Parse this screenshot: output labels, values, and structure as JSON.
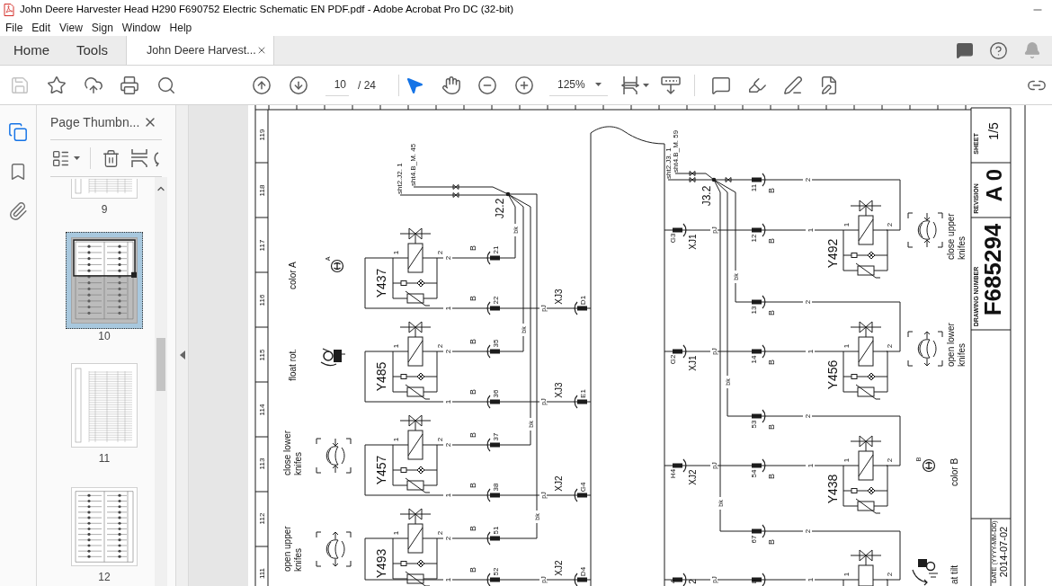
{
  "window": {
    "title": "John Deere Harvester Head H290 F690752 Electric Schematic EN PDF.pdf - Adobe Acrobat Pro DC (32-bit)"
  },
  "menu": [
    "File",
    "Edit",
    "View",
    "Sign",
    "Window",
    "Help"
  ],
  "tabs": [
    {
      "label": "Home",
      "kind": "nav",
      "selected": false
    },
    {
      "label": "Tools",
      "kind": "nav",
      "selected": false
    },
    {
      "label": "John Deere Harvest...",
      "kind": "document",
      "selected": true
    }
  ],
  "toolbar": {
    "file_tools": [
      {
        "disabled": true
      },
      {
        "disabled": false
      },
      {
        "disabled": false
      },
      {
        "disabled": false
      },
      {
        "disabled": false
      }
    ],
    "page": "10",
    "page_count": "/ 24",
    "pointer_tools": [
      {
        "selected": true
      },
      {
        "selected": false
      }
    ],
    "zoom": "125%"
  },
  "nav_rail": [
    {
      "selected": true
    },
    {
      "selected": false
    },
    {
      "selected": false
    }
  ],
  "thumbnails_panel": {
    "title": "Page Thumbn...",
    "thumbnails": [
      {
        "label": "9",
        "kind": "table",
        "selected": false
      },
      {
        "label": "10",
        "kind": "schematic",
        "selected": true
      },
      {
        "label": "11",
        "kind": "table",
        "selected": false
      },
      {
        "label": "12",
        "kind": "schematic",
        "selected": false
      }
    ]
  },
  "document": {
    "ruler": [
      "119",
      "118",
      "117",
      "116",
      "115",
      "114",
      "113",
      "112",
      "111"
    ],
    "left_circuit": {
      "refs": [
        "sht2.J2. 1",
        "sht4.B_M. 45"
      ],
      "junction": "J2.2",
      "valves": [
        {
          "name": "Y437",
          "pins": [
            "1",
            "2"
          ],
          "wire_marks": [
            "2",
            "1"
          ],
          "connectors": [
            {
              "code": "B",
              "pin": "21"
            },
            {
              "code": "B",
              "pin": "22"
            }
          ],
          "feed": "bk",
          "plug": {
            "wire": "pJ",
            "name": "XJ3",
            "pin": "D1"
          },
          "function": {
            "kind": "color",
            "letter": "A",
            "lines": [
              "color A"
            ]
          }
        },
        {
          "name": "Y485",
          "pins": [
            "1",
            "2"
          ],
          "wire_marks": [
            "2",
            "1"
          ],
          "connectors": [
            {
              "code": "B",
              "pin": "35"
            },
            {
              "code": "B",
              "pin": "36"
            }
          ],
          "feed": "bk",
          "plug": {
            "wire": "pJ",
            "name": "XJ3",
            "pin": "E1"
          },
          "function": {
            "kind": "rotator",
            "lines": [
              "float rot."
            ]
          }
        },
        {
          "name": "Y457",
          "pins": [
            "1",
            "2"
          ],
          "wire_marks": [
            "2",
            "1"
          ],
          "connectors": [
            {
              "code": "B",
              "pin": "37"
            },
            {
              "code": "B",
              "pin": "38"
            }
          ],
          "feed": "bk",
          "plug": {
            "wire": "pJ",
            "name": "XJ2",
            "pin": "G4"
          },
          "function": {
            "kind": "close",
            "lines": [
              "close lower",
              "knifes"
            ]
          }
        },
        {
          "name": "Y493",
          "pins": [
            "1",
            "2"
          ],
          "wire_marks": [
            "2",
            "1"
          ],
          "connectors": [
            {
              "code": "B",
              "pin": "51"
            },
            {
              "code": "B",
              "pin": "52"
            }
          ],
          "feed": "bk",
          "plug": {
            "wire": "pJ",
            "name": "XJ2",
            "pin": "D4"
          },
          "function": {
            "kind": "open",
            "lines": [
              "open upper",
              "knifes"
            ]
          }
        }
      ]
    },
    "right_circuit": {
      "refs": [
        "sht2.J3. 1",
        "sht4.B_M. 59"
      ],
      "junction": "J3.2",
      "valves": [
        {
          "name": "Y492",
          "pins": [
            "1",
            "2"
          ],
          "wire_marks": [
            "2",
            "1"
          ],
          "connectors": [
            {
              "code": "B",
              "pin": "11"
            },
            {
              "code": "B",
              "pin": "12"
            }
          ],
          "plug": {
            "pin": "G3",
            "name": "XJ1",
            "wire": "pJ"
          },
          "function": {
            "kind": "close",
            "lines": [
              "close upper",
              "knifes"
            ]
          }
        },
        {
          "name": "Y456",
          "pins": [
            "1",
            "2"
          ],
          "wire_marks": [
            "2",
            "1"
          ],
          "connectors": [
            {
              "code": "B",
              "pin": "13"
            },
            {
              "code": "B",
              "pin": "14"
            }
          ],
          "feed": "bk",
          "plug": {
            "pin": "G2",
            "name": "XJ1",
            "wire": "pJ"
          },
          "function": {
            "kind": "open",
            "lines": [
              "open lower",
              "knifes"
            ]
          }
        },
        {
          "name": "Y438",
          "pins": [
            "1",
            "2"
          ],
          "wire_marks": [
            "2",
            "1"
          ],
          "connectors": [
            {
              "code": "B",
              "pin": "53"
            },
            {
              "code": "B",
              "pin": "54"
            }
          ],
          "feed": "bk",
          "plug": {
            "pin": "H4",
            "name": "XJ2",
            "wire": "pJ"
          },
          "function": {
            "kind": "color",
            "letter": "B",
            "lines": [
              "color B"
            ]
          }
        },
        {
          "pins": [
            "1",
            "2"
          ],
          "wire_marks": [
            "2",
            "1"
          ],
          "connectors": [
            {
              "code": "B",
              "pin": "67"
            },
            {
              "pin": "8"
            }
          ],
          "feed": "bk",
          "plug": {
            "pin": "4",
            "name": "2",
            "wire": "pJ"
          },
          "function": {
            "kind": "tilt",
            "lines": [
              "at tilt"
            ]
          }
        }
      ]
    },
    "title_block": {
      "sheet_label": "SHEET",
      "sheet": "1/5",
      "revision_label": "REVISION",
      "revision": "A 0",
      "drawing_number_label": "DRAWING NUMBER",
      "drawing_number": "F685294",
      "date_label": "DATE (YYYY-MM-DD)",
      "date": "2014-07-02"
    }
  }
}
